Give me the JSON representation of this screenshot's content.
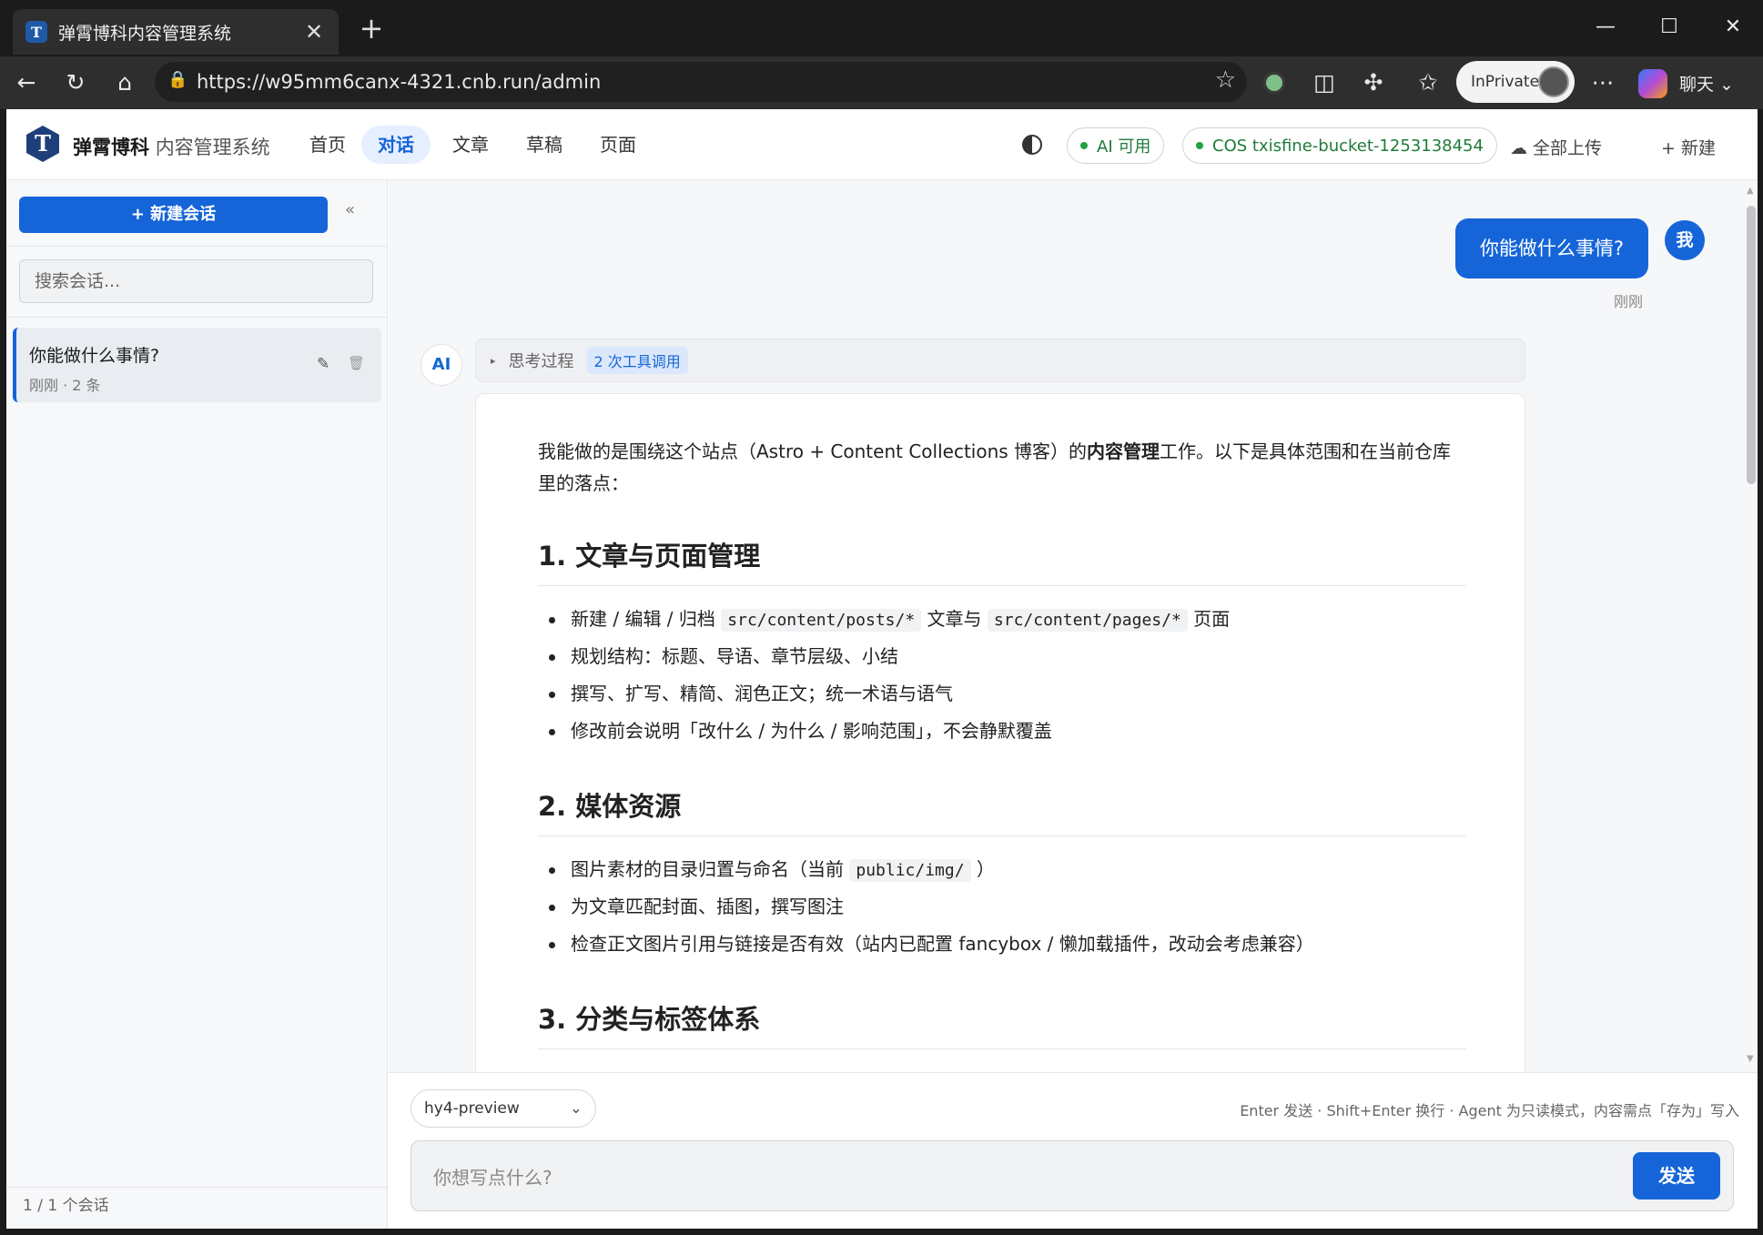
{
  "browser": {
    "tab_title": "弹霄博科内容管理系统",
    "tab_favicon": "T",
    "url": "https://w95mm6canx-4321.cnb.run/admin",
    "inprivate_label": "InPrivate",
    "chat_label": "聊天"
  },
  "header": {
    "logo_letter": "T",
    "brand_bold": "弹霄博科",
    "brand_rest": "内容管理系统",
    "nav": [
      "首页",
      "对话",
      "文章",
      "草稿",
      "页面"
    ],
    "active_nav": "对话",
    "ai_status": "AI 可用",
    "cos_status": "COS txisfine-bucket-1253138454",
    "upload_all": "全部上传",
    "new_label": "新建",
    "status_color": "#20a340",
    "accent_color": "#1565d8"
  },
  "sidebar": {
    "new_chat_label": "+ 新建会话",
    "collapse_icon": "«",
    "search_placeholder": "搜索会话...",
    "conversations": [
      {
        "title": "你能做什么事情?",
        "meta": "刚刚 · 2 条"
      }
    ],
    "footer": "1 / 1 个会话"
  },
  "chat": {
    "user_message": "你能做什么事情?",
    "user_avatar": "我",
    "user_time": "刚刚",
    "ai_avatar": "AI",
    "thinking_label": "思考过程",
    "tool_calls_badge": "2 次工具调用",
    "intro_pre": "我能做的是围绕这个站点（Astro + Content Collections 博客）的",
    "intro_bold": "内容管理",
    "intro_post": "工作。以下是具体范围和在当前仓库里的落点：",
    "sections": [
      {
        "heading": "1. 文章与页面管理",
        "items": [
          {
            "pre": "新建 / 编辑 / 归档 ",
            "code1": "src/content/posts/*",
            "mid": " 文章与 ",
            "code2": "src/content/pages/*",
            "post": " 页面"
          },
          {
            "pre": "规划结构：标题、导语、章节层级、小结"
          },
          {
            "pre": "撰写、扩写、精简、润色正文；统一术语与语气"
          },
          {
            "pre": "修改前会说明「改什么 / 为什么 / 影响范围」，不会静默覆盖"
          }
        ]
      },
      {
        "heading": "2. 媒体资源",
        "items": [
          {
            "pre": "图片素材的目录归置与命名（当前 ",
            "code1": "public/img/",
            "post": " ）"
          },
          {
            "pre": "为文章匹配封面、插图，撰写图注"
          },
          {
            "pre": "检查正文图片引用与链接是否有效（站内已配置 fancybox / 懒加载插件，改动会考虑兼容）"
          }
        ]
      },
      {
        "heading": "3. 分类与标签体系",
        "items": []
      }
    ]
  },
  "composer": {
    "model": "hy4-preview",
    "hint": "Enter 发送 · Shift+Enter 换行 · Agent 为只读模式，内容需点「存为」写入",
    "placeholder": "你想写点什么?",
    "send_label": "发送"
  }
}
